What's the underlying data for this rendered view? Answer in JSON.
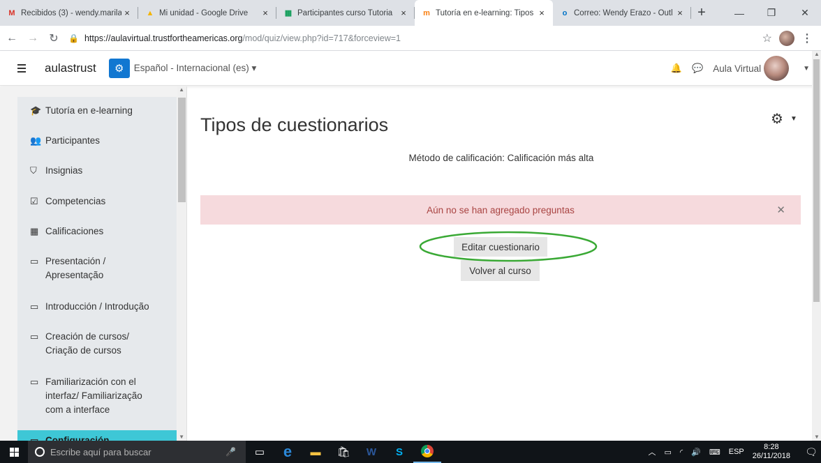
{
  "browser": {
    "tabs": [
      {
        "label": "Recibidos (3) - wendy.marila",
        "favicon": "gmail-icon",
        "fav_glyph": "M",
        "fav_color": "#d93025",
        "active": false
      },
      {
        "label": "Mi unidad - Google Drive",
        "favicon": "google-drive-icon",
        "fav_glyph": "▲",
        "fav_color": "#f4b400",
        "active": false
      },
      {
        "label": "Participantes curso Tutoria",
        "favicon": "google-sheets-icon",
        "fav_glyph": "▦",
        "fav_color": "#0f9d58",
        "active": false
      },
      {
        "label": "Tutoría en e-learning: Tipos",
        "favicon": "moodle-icon",
        "fav_glyph": "m",
        "fav_color": "#f98012",
        "active": true
      },
      {
        "label": "Correo: Wendy Erazo - Outl",
        "favicon": "outlook-icon",
        "fav_glyph": "o",
        "fav_color": "#0072c6",
        "active": false
      }
    ],
    "url_host": "https://aulavirtual.trustfortheamericas.org",
    "url_path": "/mod/quiz/view.php?id=717&forceview=1"
  },
  "navbar": {
    "brand": "aulastrust",
    "language": "Español - Internacional (es) ▾",
    "user_name": "Aula Virtual"
  },
  "sidebar": {
    "items": [
      {
        "label": "Tutoría en e-learning",
        "icon": "graduation-cap-icon",
        "glyph": "🎓"
      },
      {
        "label": "Participantes",
        "icon": "users-icon",
        "glyph": "👥"
      },
      {
        "label": "Insignias",
        "icon": "shield-icon",
        "glyph": "⛉"
      },
      {
        "label": "Competencias",
        "icon": "checkbox-icon",
        "glyph": "☑"
      },
      {
        "label": "Calificaciones",
        "icon": "table-icon",
        "glyph": "▦"
      },
      {
        "label": "Presentación /\nApresentação",
        "icon": "folder-icon",
        "glyph": "▭"
      },
      {
        "label": "Introducción / Introdução",
        "icon": "folder-icon",
        "glyph": "▭"
      },
      {
        "label": "Creación de cursos/\nCriação de cursos",
        "icon": "folder-icon",
        "glyph": "▭"
      },
      {
        "label": "Familiarización con el\ninterfaz/ Familiarização\ncom a interface",
        "icon": "folder-icon",
        "glyph": "▭"
      },
      {
        "label": "Configuración",
        "icon": "folder-icon",
        "glyph": "▭",
        "active": true
      }
    ]
  },
  "main": {
    "title": "Tipos de cuestionarios",
    "grading_method": "Método de calificación: Calificación más alta",
    "alert_text": "Aún no se han agregado preguntas",
    "edit_button": "Editar cuestionario",
    "back_button": "Volver al curso",
    "highlight_color": "#3aa935"
  },
  "taskbar": {
    "search_placeholder": "Escribe aquí para buscar",
    "language": "ESP",
    "time": "8:28",
    "date": "26/11/2018"
  }
}
